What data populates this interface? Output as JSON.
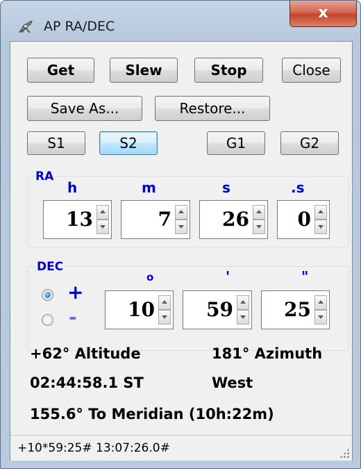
{
  "window": {
    "title": "AP  RA/DEC",
    "close_glyph": "x",
    "icon": "telescope-icon"
  },
  "toolbar": {
    "get_label": "Get",
    "slew_label": "Slew",
    "stop_label": "Stop",
    "close_label": "Close",
    "save_as_label": "Save As...",
    "restore_label": "Restore...",
    "s1_label": "S1",
    "s2_label": "S2",
    "g1_label": "G1",
    "g2_label": "G2"
  },
  "ra": {
    "label": "RA",
    "headers": {
      "h": "h",
      "m": "m",
      "s": "s",
      "fs": ".s"
    },
    "hours": "13",
    "minutes": "7",
    "seconds": "26",
    "tenths": "0"
  },
  "dec": {
    "label": "DEC",
    "headers": {
      "deg": "o",
      "min": "'",
      "sec": "\""
    },
    "sign_plus": "+",
    "sign_minus": "-",
    "selected_sign": "+",
    "degrees": "10",
    "minutes": "59",
    "seconds": "25"
  },
  "info": {
    "altitude": "+62° Altitude",
    "azimuth": "181° Azimuth",
    "sidereal_time": "02:44:58.1 ST",
    "side": "West",
    "meridian": "155.6° To Meridian (10h:22m)"
  },
  "status": {
    "text": "+10*59:25#  13:07:26.0#"
  },
  "colors": {
    "label_blue": "#0000cc",
    "close_red": "#c2452b",
    "focus_blue": "#3c7fb1"
  }
}
